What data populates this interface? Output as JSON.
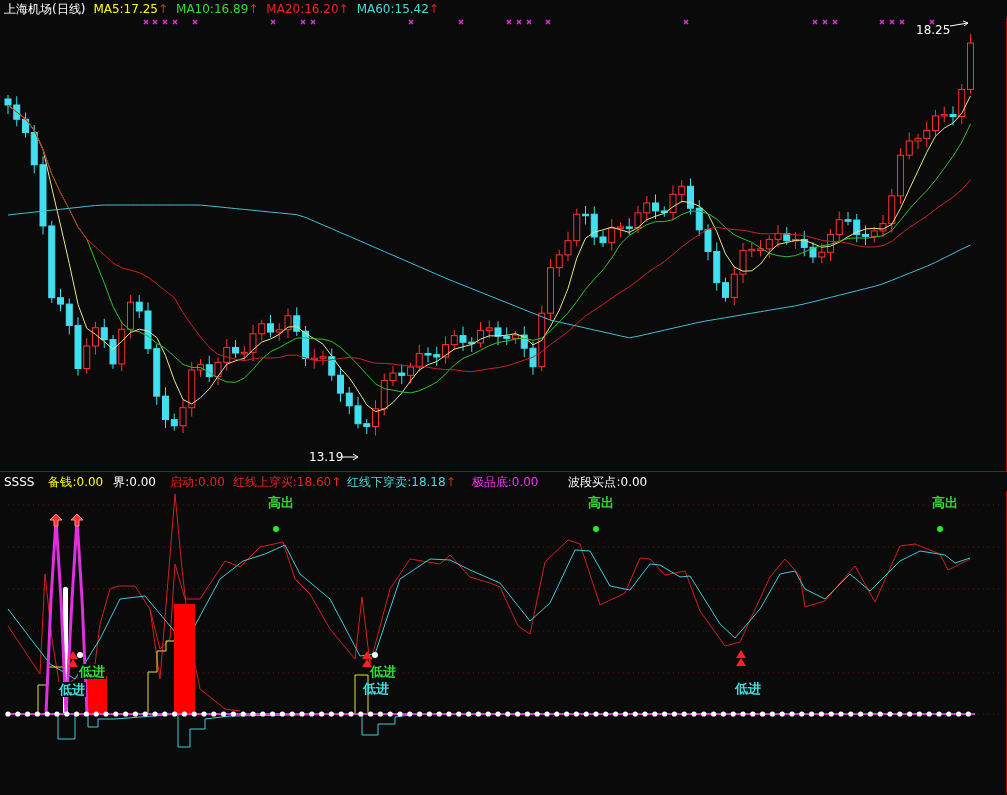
{
  "main_panel": {
    "title": "上海机场(日线)",
    "legend": [
      {
        "text": "MA5:17.25",
        "color": "#ffff00",
        "arrow": "↑"
      },
      {
        "text": "MA10:16.89",
        "color": "#33dd33",
        "arrow": "↑"
      },
      {
        "text": "MA20:16.20",
        "color": "#ee2222",
        "arrow": "↑"
      },
      {
        "text": "MA60:15.42",
        "color": "#44dddd",
        "arrow": "↑"
      }
    ],
    "high_label": "18.25",
    "low_label": "13.19"
  },
  "indicator_panel": {
    "legend": [
      {
        "text": "SSSS",
        "color": "#ffffff"
      },
      {
        "text": "备钱:0.00",
        "color": "#ffff00"
      },
      {
        "text": "界:0.00",
        "color": "#ffffff"
      },
      {
        "text": "启动:0.00",
        "color": "#ee2222"
      },
      {
        "text": "红线上穿买:18.60",
        "color": "#ee2222",
        "arrow": "↑"
      },
      {
        "text": "红线下穿卖:18.18",
        "color": "#44dddd",
        "arrow": "↑"
      },
      {
        "text": "极品底:0.00",
        "color": "#ee33ee"
      },
      {
        "text": "波段买点:0.00",
        "color": "#ffffff"
      }
    ],
    "signals": [
      {
        "kind": "high",
        "text": "高出",
        "color": "#33dd33"
      },
      {
        "kind": "high",
        "text": "高出",
        "color": "#33dd33"
      },
      {
        "kind": "high",
        "text": "高出",
        "color": "#33dd33"
      },
      {
        "kind": "low",
        "text": "低进",
        "color": "#33dd33"
      },
      {
        "kind": "low",
        "text": "低进",
        "color": "#44dddd"
      },
      {
        "kind": "low",
        "text": "低进",
        "color": "#33dd33"
      },
      {
        "kind": "low",
        "text": "低进",
        "color": "#44dddd"
      },
      {
        "kind": "low",
        "text": "低进",
        "color": "#44dddd"
      }
    ]
  }
}
